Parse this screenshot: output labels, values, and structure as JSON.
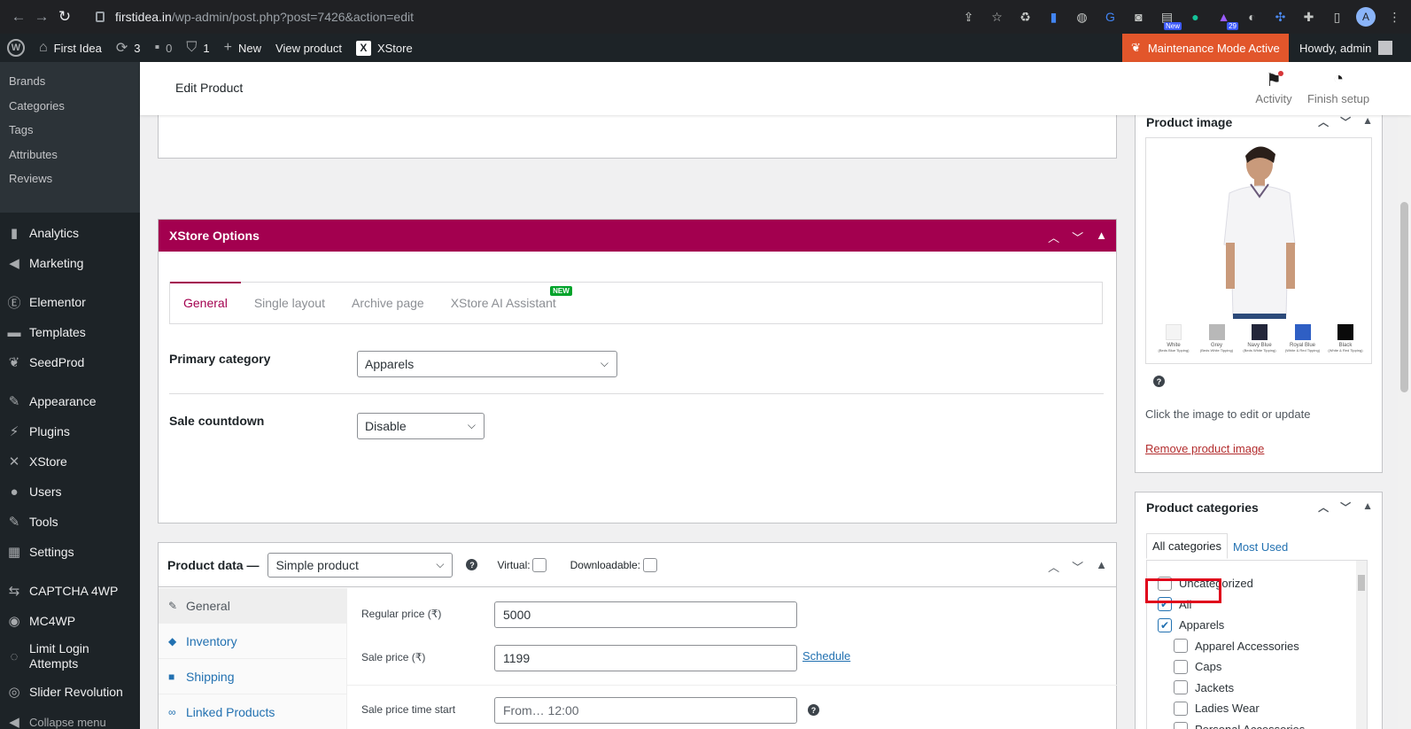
{
  "browser": {
    "url_host": "firstidea.in",
    "url_path": "/wp-admin/post.php?post=7426&action=edit",
    "ext_badge_new": "New",
    "ext_badge_count": "29",
    "profile_initial": "A"
  },
  "adminbar": {
    "site_name": "First Idea",
    "updates_count": "3",
    "comments_count": "0",
    "security_count": "1",
    "new_label": "New",
    "view_product_label": "View product",
    "xstore_label": "XStore",
    "maintenance_label": "Maintenance Mode Active",
    "howdy_label": "Howdy, admin"
  },
  "sidebar": {
    "sub_items": [
      "Brands",
      "Categories",
      "Tags",
      "Attributes",
      "Reviews"
    ],
    "menu_items": [
      {
        "label": "Analytics",
        "icon": "bar-chart-icon"
      },
      {
        "label": "Marketing",
        "icon": "megaphone-icon"
      },
      {
        "label": "Elementor",
        "icon": "elementor-icon"
      },
      {
        "label": "Templates",
        "icon": "folder-icon"
      },
      {
        "label": "SeedProd",
        "icon": "seedprod-icon"
      },
      {
        "label": "Appearance",
        "icon": "brush-icon"
      },
      {
        "label": "Plugins",
        "icon": "plug-icon"
      },
      {
        "label": "XStore",
        "icon": "xstore-icon"
      },
      {
        "label": "Users",
        "icon": "user-icon"
      },
      {
        "label": "Tools",
        "icon": "wrench-icon"
      },
      {
        "label": "Settings",
        "icon": "settings-icon"
      },
      {
        "label": "CAPTCHA 4WP",
        "icon": "captcha-icon"
      },
      {
        "label": "MC4WP",
        "icon": "mc4wp-icon"
      },
      {
        "label": "Limit Login Attempts",
        "icon": "limit-login-icon"
      },
      {
        "label": "Slider Revolution",
        "icon": "slider-icon"
      }
    ],
    "collapse_label": "Collapse menu"
  },
  "header": {
    "title": "Edit Product",
    "activity_label": "Activity",
    "finish_setup_label": "Finish setup"
  },
  "xstore_options": {
    "title": "XStore Options",
    "tabs": [
      "General",
      "Single layout",
      "Archive page",
      "XStore AI Assistant"
    ],
    "new_badge": "NEW",
    "primary_category_label": "Primary category",
    "primary_category_value": "Apparels",
    "sale_countdown_label": "Sale countdown",
    "sale_countdown_value": "Disable"
  },
  "product_data": {
    "title": "Product data —",
    "type_value": "Simple product",
    "virtual_label": "Virtual:",
    "downloadable_label": "Downloadable:",
    "tabs": [
      "General",
      "Inventory",
      "Shipping",
      "Linked Products"
    ],
    "regular_price_label": "Regular price (₹)",
    "regular_price_value": "5000",
    "sale_price_label": "Sale price (₹)",
    "sale_price_value": "1199",
    "schedule_label": "Schedule",
    "sale_start_label": "Sale price time start",
    "sale_start_value": "From… 12:00"
  },
  "product_image": {
    "title": "Product image",
    "hint": "Click the image to edit or update",
    "remove_label": "Remove product image",
    "swatches": [
      {
        "name": "White",
        "sub": "(Beds Blue Tipping)",
        "color": "#f4f4f4"
      },
      {
        "name": "Grey",
        "sub": "(Beds White Tipping)",
        "color": "#b8b8b8"
      },
      {
        "name": "Navy Blue",
        "sub": "(Beds White Tipping)",
        "color": "#23263a"
      },
      {
        "name": "Royal Blue",
        "sub": "(White & Red Tipping)",
        "color": "#2f5fc4"
      },
      {
        "name": "Black",
        "sub": "(White & Red Tipping)",
        "color": "#0a0a0a"
      }
    ]
  },
  "product_categories": {
    "title": "Product categories",
    "tab_all": "All categories",
    "tab_most_used": "Most Used",
    "items": [
      {
        "label": "Uncategorized",
        "checked": false,
        "child": false
      },
      {
        "label": "All",
        "checked": true,
        "child": false
      },
      {
        "label": "Apparels",
        "checked": true,
        "child": false
      },
      {
        "label": "Apparel Accessories",
        "checked": false,
        "child": true
      },
      {
        "label": "Caps",
        "checked": false,
        "child": true
      },
      {
        "label": "Jackets",
        "checked": false,
        "child": true
      },
      {
        "label": "Ladies Wear",
        "checked": false,
        "child": true
      },
      {
        "label": "Personal Accessories",
        "checked": false,
        "child": true
      }
    ]
  },
  "colors": {
    "xstore_accent": "#a3004f",
    "maintenance_bg": "#e2562b",
    "highlight_border": "#e0001b",
    "wp_link": "#2271b1"
  }
}
